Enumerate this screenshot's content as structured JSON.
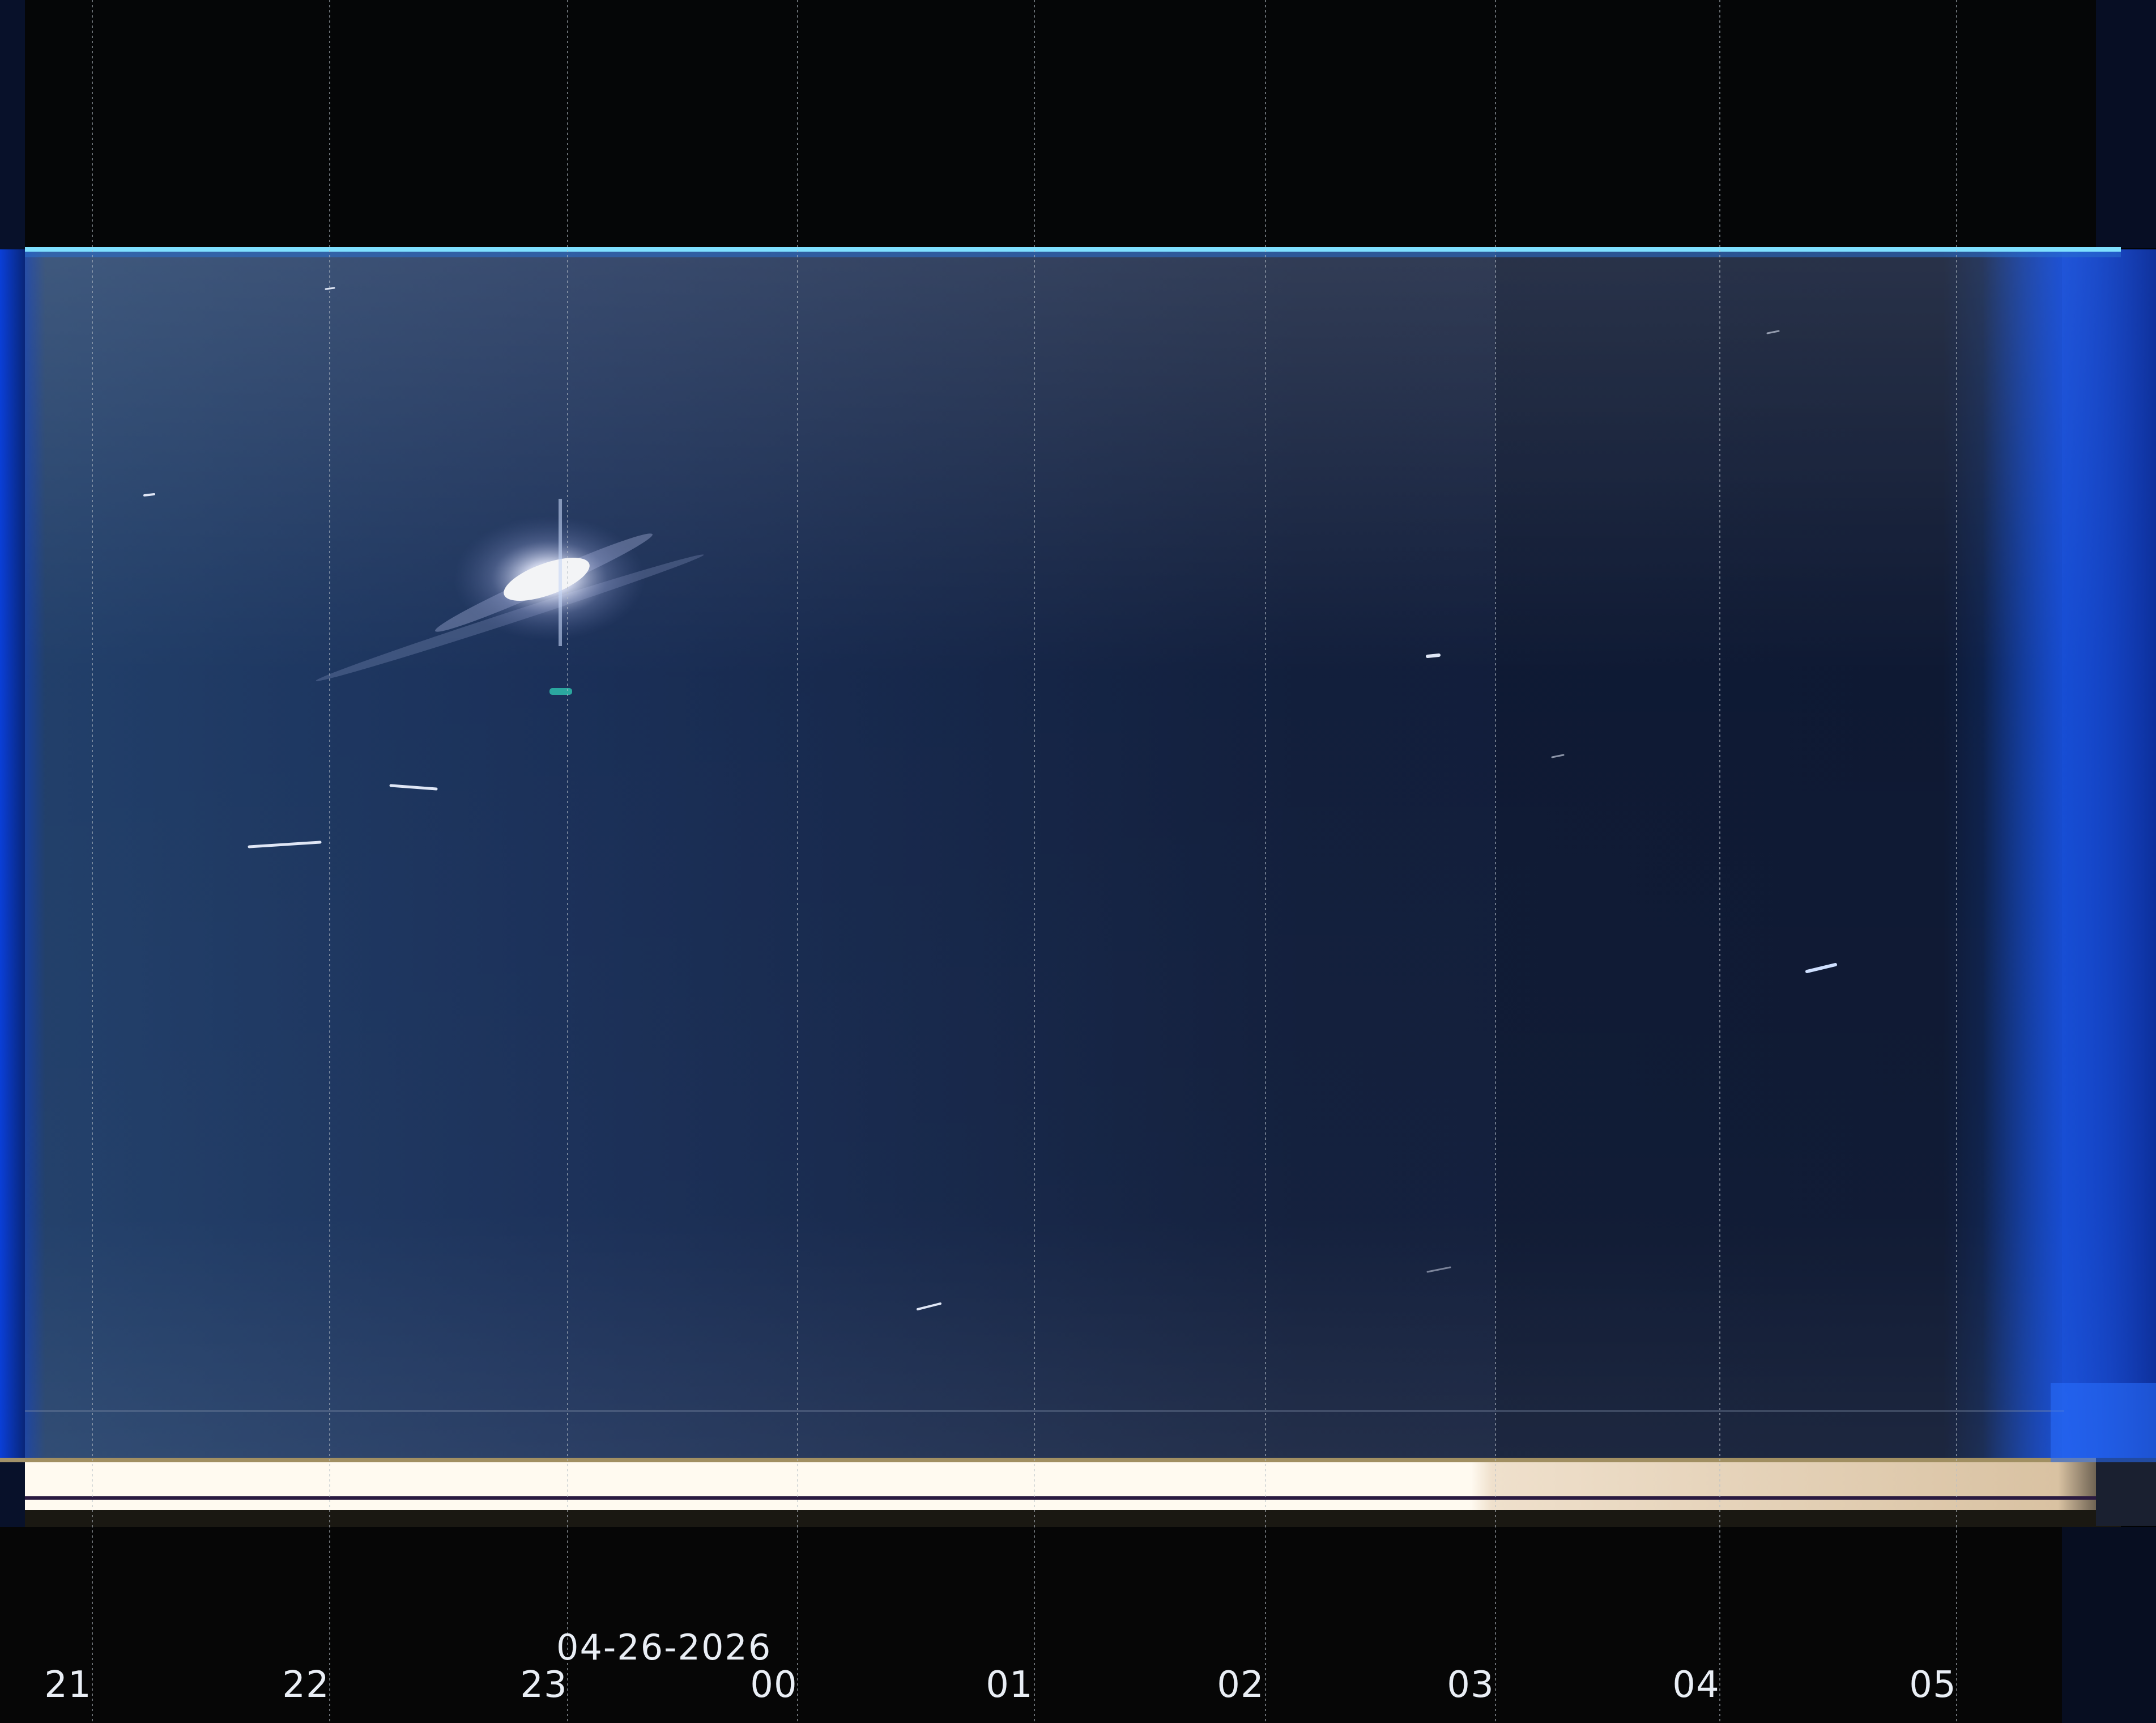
{
  "date_label": "04-26-2026",
  "hour_labels": [
    "21",
    "22",
    "23",
    "00",
    "01",
    "02",
    "03",
    "04",
    "05"
  ],
  "colors": {
    "sky_dark": "#0a1530",
    "sky_twilight": "#1e5cff",
    "horizon_band": "#fff8ea",
    "grid_line": "#b8c0c8"
  }
}
